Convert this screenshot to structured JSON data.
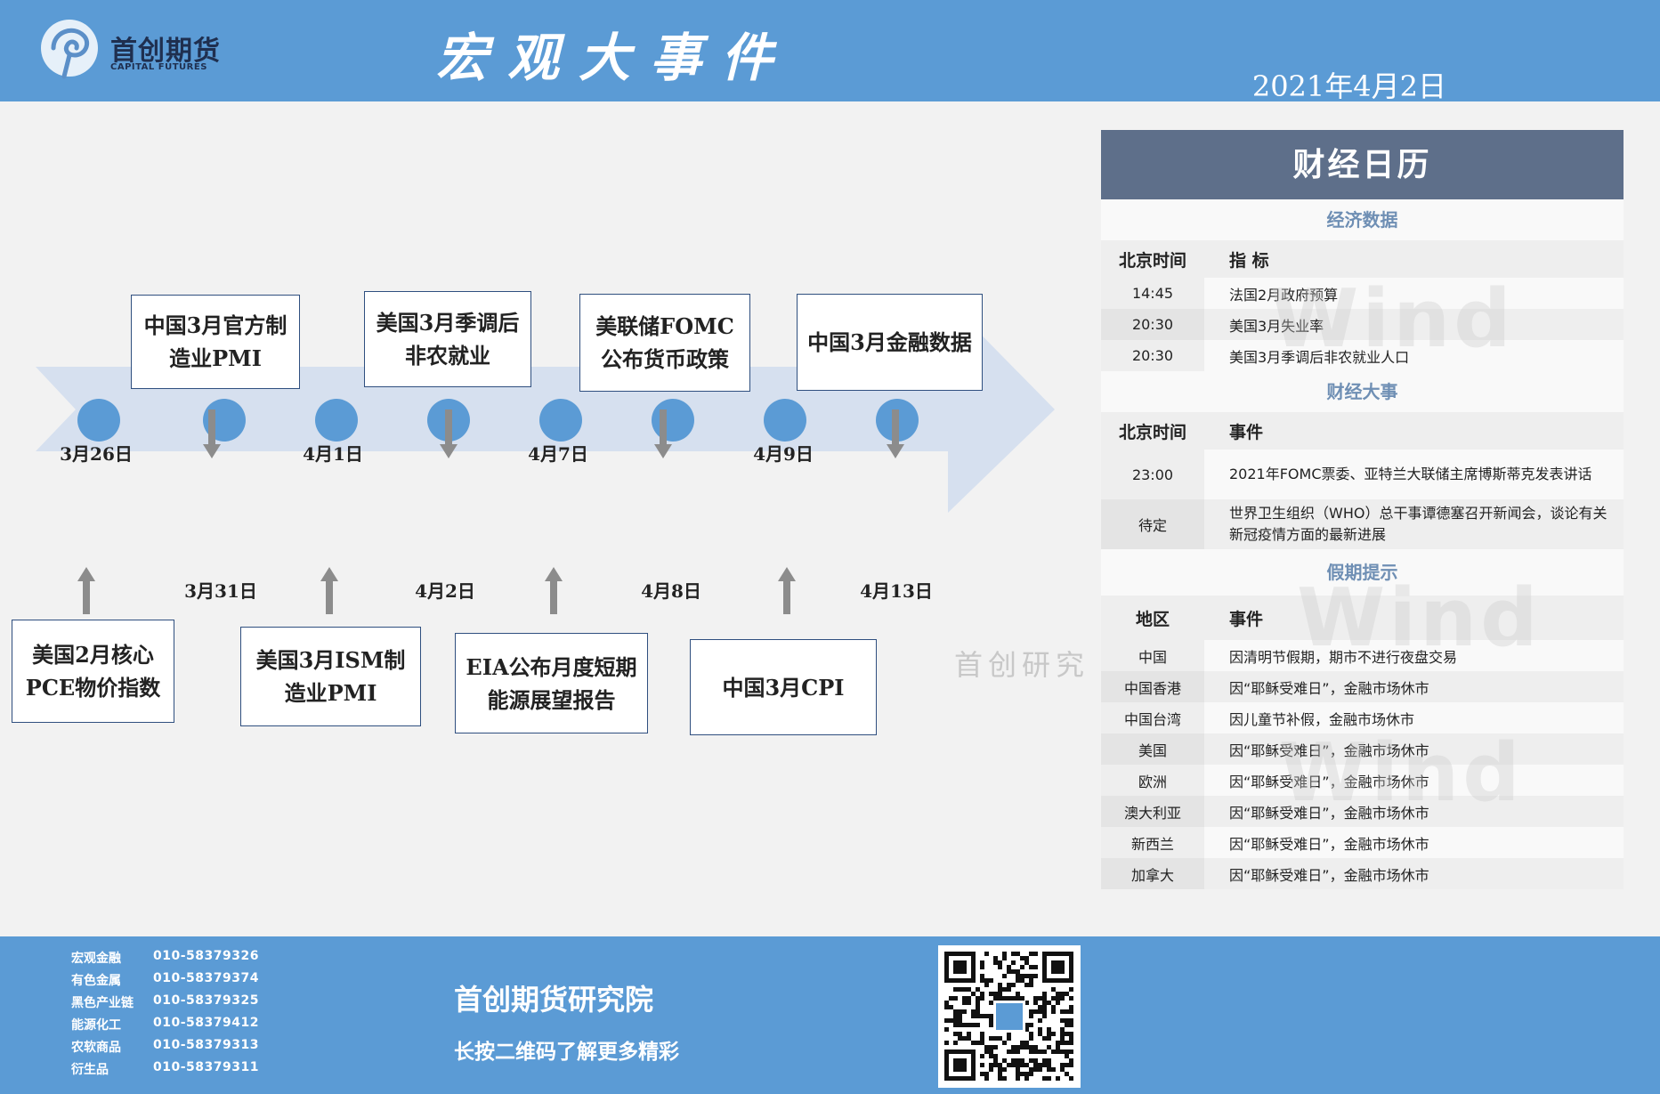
{
  "header": {
    "logo_cn": "首创期货",
    "logo_en": "CAPITAL FUTURES",
    "title": "宏观大事件",
    "date": "2021年4月2日"
  },
  "timeline": {
    "watermark": "首创研究",
    "dates_top": [
      "3月26日",
      "4月1日",
      "4月7日",
      "4月9日"
    ],
    "dates_bottom": [
      "3月31日",
      "4月2日",
      "4月8日",
      "4月13日"
    ],
    "events_top": [
      "中国3月官方制造业PMI",
      "美国3月季调后非农就业",
      "美联储FOMC公布货币政策",
      "中国3月金融数据"
    ],
    "events_bottom": [
      "美国2月核心PCE物价指数",
      "美国3月ISM制造业PMI",
      "EIA公布月度短期能源展望报告",
      "中国3月CPI"
    ],
    "colors": {
      "arrow": "#d6e0ef",
      "node": "#5b9bd5",
      "pointer": "#8c8c8c"
    }
  },
  "calendar": {
    "title": "财经日历",
    "economic": {
      "section": "经济数据",
      "headers": [
        "北京时间",
        "指  标"
      ],
      "rows": [
        [
          "14:45",
          "法国2月政府预算"
        ],
        [
          "20:30",
          "美国3月失业率"
        ],
        [
          "20:30",
          "美国3月季调后非农就业人口"
        ]
      ]
    },
    "events": {
      "section": "财经大事",
      "headers": [
        "北京时间",
        "事件"
      ],
      "rows": [
        [
          "23:00",
          "2021年FOMC票委、亚特兰大联储主席博斯蒂克发表讲话"
        ],
        [
          "待定",
          "世界卫生组织（WHO）总干事谭德塞召开新闻会，谈论有关新冠疫情方面的最新进展"
        ]
      ]
    },
    "holidays": {
      "section": "假期提示",
      "headers": [
        "地区",
        "事件"
      ],
      "rows": [
        [
          "中国",
          "因清明节假期，期市不进行夜盘交易"
        ],
        [
          "中国香港",
          "因“耶稣受难日”，金融市场休市"
        ],
        [
          "中国台湾",
          "因儿童节补假，金融市场休市"
        ],
        [
          "美国",
          "因“耶稣受难日”，金融市场休市"
        ],
        [
          "欧洲",
          "因“耶稣受难日”，金融市场休市"
        ],
        [
          "澳大利亚",
          "因“耶稣受难日”，金融市场休市"
        ],
        [
          "新西兰",
          "因“耶稣受难日”，金融市场休市"
        ],
        [
          "加拿大",
          "因“耶稣受难日”，金融市场休市"
        ]
      ]
    },
    "watermark": "Wind"
  },
  "footer": {
    "contacts": [
      {
        "dept": "宏观金融",
        "phone": "010-58379326"
      },
      {
        "dept": "有色金属",
        "phone": "010-58379374"
      },
      {
        "dept": "黑色产业链",
        "phone": "010-58379325"
      },
      {
        "dept": "能源化工",
        "phone": "010-58379412"
      },
      {
        "dept": "农软商品",
        "phone": "010-58379313"
      },
      {
        "dept": "衍生品",
        "phone": "010-58379311"
      }
    ],
    "institute": "首创期货研究院",
    "slogan": "长按二维码了解更多精彩",
    "qr_icon": "qr-code-icon"
  }
}
